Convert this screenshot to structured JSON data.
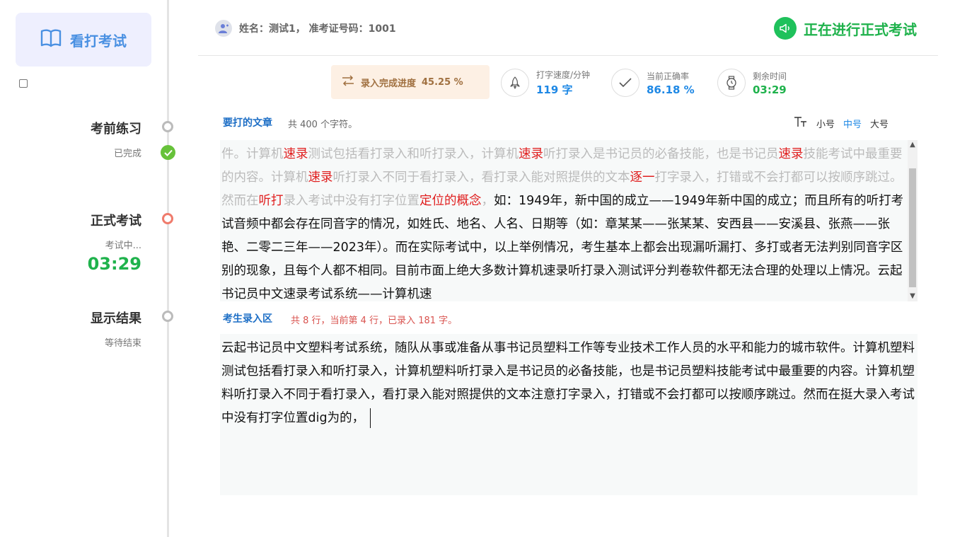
{
  "sidebar": {
    "brand": "看打考试",
    "steps": [
      {
        "title": "考前练习",
        "sub": "已完成"
      },
      {
        "title": "正式考试",
        "sub": "考试中...",
        "timer": "03:29"
      },
      {
        "title": "显示结果",
        "sub": "等待结束"
      }
    ]
  },
  "header": {
    "user_info": "姓名：测试1， 准考证号码：1001",
    "status": "正在进行正式考试"
  },
  "stats": {
    "progress_label": "录入完成进度",
    "progress_value": "45.25 %",
    "speed_label": "打字速度/分钟",
    "speed_value": "119 字",
    "accuracy_label": "当前正确率",
    "accuracy_value": "86.18 %",
    "time_label": "剩余时间",
    "time_value": "03:29"
  },
  "article": {
    "title": "要打的文章",
    "note": "共 400 个字符。",
    "font_sizes": [
      "小号",
      "中号",
      "大号"
    ],
    "segments": [
      {
        "t": "件。计算机",
        "c": "done"
      },
      {
        "t": "速录",
        "c": "err"
      },
      {
        "t": "测试包括看打录入和听打录入，计算机",
        "c": "done"
      },
      {
        "t": "速录",
        "c": "err"
      },
      {
        "t": "听打录入是书记员的必备技能，也是书记员",
        "c": "done"
      },
      {
        "t": "速录",
        "c": "err"
      },
      {
        "t": "技能考试中最重要的内容。计算机",
        "c": "done"
      },
      {
        "t": "速录",
        "c": "err"
      },
      {
        "t": "听打录入不同于看打录入，看打录入能对照提供的文本",
        "c": "done"
      },
      {
        "t": "逐一",
        "c": "err"
      },
      {
        "t": "打字录入，打错或不会打都可以按顺序跳过。然而在",
        "c": "done"
      },
      {
        "t": "听打",
        "c": "err"
      },
      {
        "t": "录入考试中没有打字位置",
        "c": "done"
      },
      {
        "t": "定位的概念",
        "c": "err"
      },
      {
        "t": "，",
        "c": "done"
      },
      {
        "t": "如：1949年，新中国的成立——1949年新中国的成立；而且所有的听打考试音频中都会存在同音字的情况，如姓氏、地名、人名、日期等（如：章某某——张某某、安西县——安溪县、张燕——张艳、二零二三年——2023年）。而在实际考试中，以上举例情况，考生基本上都会出现漏听漏打、多打或者无法判别同音字区别的现象，且每个人都不相同。目前市面上绝大多数计算机速录听打录入测试评分判卷软件都无法合理的处理以上情况。云起书记员中文速录考试系统——计算机速",
        "c": "pending"
      }
    ]
  },
  "input": {
    "title": "考生录入区",
    "note": "共 8 行，当前第 4 行，已录入 181 字。",
    "text": "云起书记员中文塑料考试系统，随队从事或准备从事书记员塑料工作等专业技术工作人员的水平和能力的城市软件。计算机塑料测试包括看打录入和听打录入，计算机塑料听打录入是书记员的必备技能，也是书记员塑料技能考试中最重要的内容。计算机塑料听打录入不同于看打录入，看打录入能对照提供的文本注意打字录入，打错或不会打都可以按顺序跳过。然而在挺大录入考试中没有打字位置dig为的，"
  },
  "colors": {
    "accent_blue": "#1e88e5",
    "accent_green": "#1fb24c",
    "error_red": "#e02020"
  }
}
